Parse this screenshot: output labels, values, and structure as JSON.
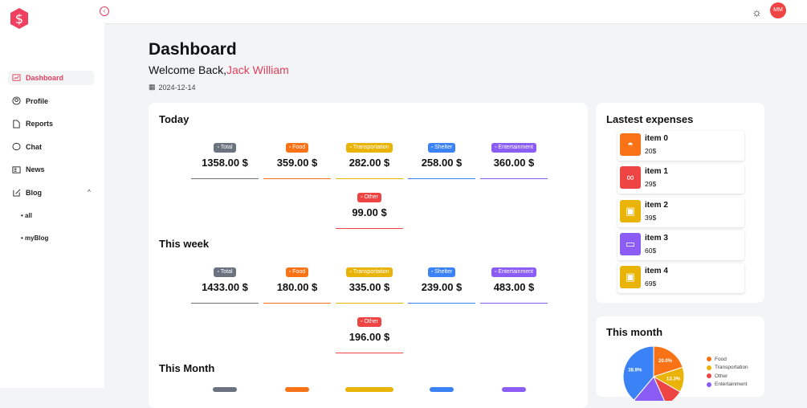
{
  "sidebar": {
    "items": [
      {
        "label": "Dashboard"
      },
      {
        "label": "Profile"
      },
      {
        "label": "Reports"
      },
      {
        "label": "Chat"
      },
      {
        "label": "News"
      },
      {
        "label": "Blog"
      }
    ],
    "blog_sub": [
      "all",
      "myBlog"
    ]
  },
  "topbar": {
    "avatar_initials": "MM"
  },
  "header": {
    "title": "Dashboard",
    "welcome": "Welcome Back,",
    "user": "Jack William",
    "date": "2024-12-14"
  },
  "sections": [
    {
      "title": "Today",
      "stats": [
        {
          "label": "Total",
          "value": "1358.00 $",
          "color": "#6b7280"
        },
        {
          "label": "Food",
          "value": "359.00 $",
          "color": "#f97316"
        },
        {
          "label": "Transportation",
          "value": "282.00 $",
          "color": "#eab308"
        },
        {
          "label": "Shelter",
          "value": "258.00 $",
          "color": "#3b82f6"
        },
        {
          "label": "Entertainment",
          "value": "360.00 $",
          "color": "#8b5cf6"
        },
        {
          "label": "Other",
          "value": "99.00 $",
          "color": "#ef4444"
        }
      ]
    },
    {
      "title": "This week",
      "stats": [
        {
          "label": "Total",
          "value": "1433.00 $",
          "color": "#6b7280"
        },
        {
          "label": "Food",
          "value": "180.00 $",
          "color": "#f97316"
        },
        {
          "label": "Transportation",
          "value": "335.00 $",
          "color": "#eab308"
        },
        {
          "label": "Shelter",
          "value": "239.00 $",
          "color": "#3b82f6"
        },
        {
          "label": "Entertainment",
          "value": "483.00 $",
          "color": "#8b5cf6"
        },
        {
          "label": "Other",
          "value": "196.00 $",
          "color": "#ef4444"
        }
      ]
    },
    {
      "title": "This Month"
    }
  ],
  "latest": {
    "title": "Lastest expenses",
    "items": [
      {
        "name": "item 0",
        "amount": "20$",
        "color": "#f97316",
        "icon": "food-icon"
      },
      {
        "name": "item 1",
        "amount": "29$",
        "color": "#ef4444",
        "icon": "other-icon"
      },
      {
        "name": "item 2",
        "amount": "39$",
        "color": "#eab308",
        "icon": "bus-icon"
      },
      {
        "name": "item 3",
        "amount": "60$",
        "color": "#8b5cf6",
        "icon": "monitor-icon"
      },
      {
        "name": "item 4",
        "amount": "69$",
        "color": "#eab308",
        "icon": "bus-icon"
      }
    ]
  },
  "chart_data": {
    "type": "pie",
    "title": "This month",
    "slices": [
      {
        "label": "Food",
        "value": 20.0,
        "color": "#f97316"
      },
      {
        "label": "Transportation",
        "value": 13.3,
        "color": "#eab308"
      },
      {
        "label": "Other",
        "value": 10.0,
        "color": "#ef4444"
      },
      {
        "label": "Entertainment",
        "value": 17.8,
        "color": "#8b5cf6"
      },
      {
        "label": "Shelter",
        "value": 38.9,
        "color": "#3b82f6"
      }
    ],
    "data_labels": [
      "20.0%",
      "13.3%",
      "38.9%"
    ],
    "legend": [
      "Food",
      "Transportation",
      "Other",
      "Entertainment"
    ]
  }
}
